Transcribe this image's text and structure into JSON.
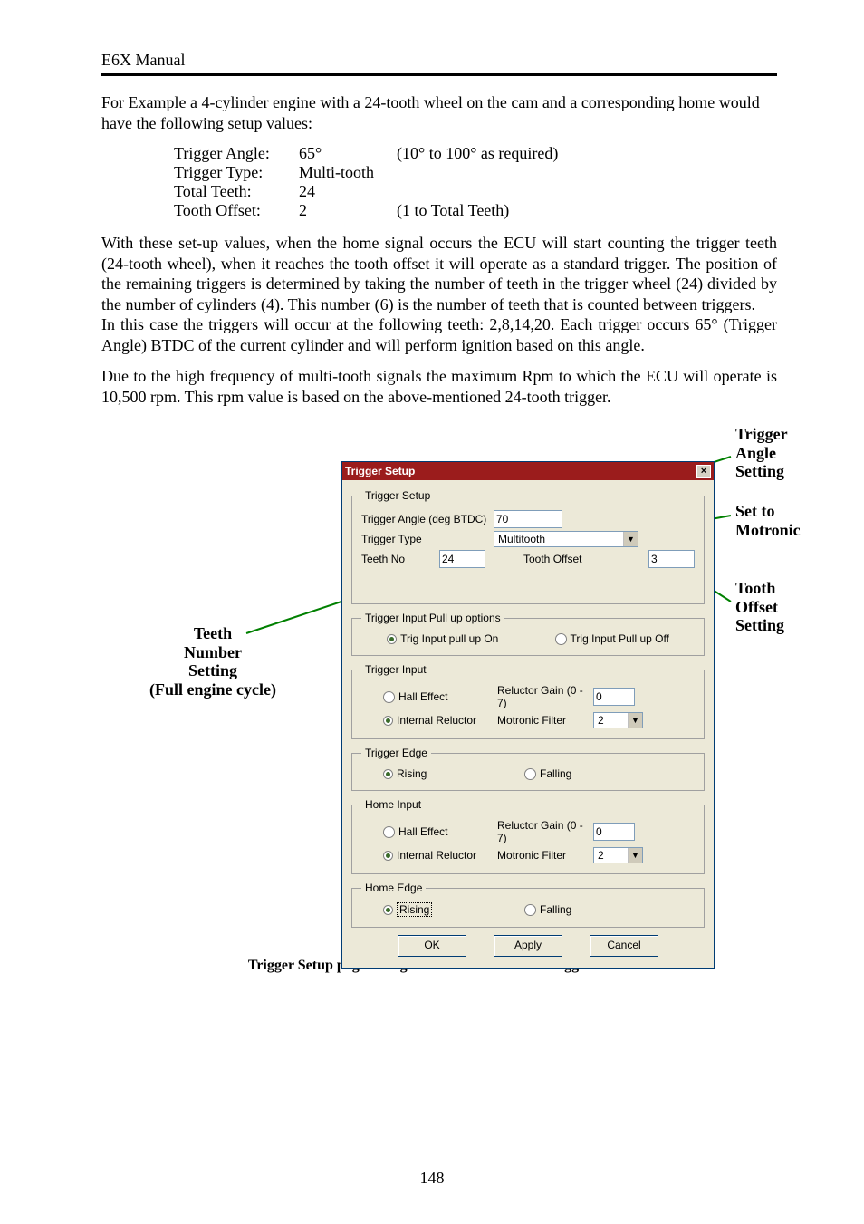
{
  "doc": {
    "header": "E6X Manual",
    "intro": "For Example a 4-cylinder engine with a 24-tooth wheel on the cam and a corresponding home would have the following setup values:",
    "setup": {
      "rows": [
        {
          "label": "Trigger Angle:",
          "value": "65°",
          "note": "(10° to 100° as required)"
        },
        {
          "label": "Trigger Type:",
          "value": "Multi-tooth",
          "note": ""
        },
        {
          "label": "Total Teeth:",
          "value": "24",
          "note": ""
        },
        {
          "label": "Tooth Offset:",
          "value": "2",
          "note": "(1 to Total Teeth)"
        }
      ]
    },
    "para2": "With these set-up values, when the home signal occurs the ECU will start counting the trigger teeth (24-tooth wheel), when it reaches the tooth offset it will operate as a standard trigger.  The position of the remaining triggers is determined by taking the number of teeth in the trigger wheel (24) divided by the number of cylinders (4).  This number (6) is the number of teeth that is counted between triggers.",
    "para3": "In this case the triggers will occur at the following teeth: 2,8,14,20.   Each trigger occurs 65° (Trigger Angle) BTDC of the current cylinder and will perform ignition based on this angle.",
    "para4": "Due to the high frequency of multi-tooth signals the maximum Rpm to which the ECU will operate is 10,500 rpm.  This rpm value is based on the above-mentioned 24-tooth trigger.",
    "caption": "Trigger Setup page configuration for Multitooth trigger wheel",
    "pagenum": "148"
  },
  "callouts": {
    "left1": "Teeth",
    "left2": "Number",
    "left3": "Setting",
    "left4": "(Full engine cycle)",
    "r1a": "Trigger",
    "r1b": "Angle",
    "r1c": "Setting",
    "r2a": "Set to",
    "r2b": "Motronic",
    "r3a": "Tooth",
    "r3b": "Offset",
    "r3c": "Setting"
  },
  "dlg": {
    "title": "Trigger Setup",
    "close": "×",
    "grp_trigger": {
      "legend": "Trigger Setup",
      "angle_label": "Trigger Angle (deg BTDC)",
      "angle_value": "70",
      "type_label": "Trigger Type",
      "type_value": "Multitooth",
      "teeth_label": "Teeth No",
      "teeth_value": "24",
      "offset_label": "Tooth Offset",
      "offset_value": "3"
    },
    "grp_pullup": {
      "legend": "Trigger Input Pull up options",
      "on": "Trig Input pull up On",
      "off": "Trig Input Pull up Off"
    },
    "grp_triginput": {
      "legend": "Trigger Input",
      "hall": "Hall Effect",
      "reluctor": "Internal Reluctor",
      "gain_label": "Reluctor Gain (0 - 7)",
      "gain_value": "0",
      "filter_label": "Motronic Filter",
      "filter_value": "2"
    },
    "grp_trigedge": {
      "legend": "Trigger Edge",
      "rising": "Rising",
      "falling": "Falling"
    },
    "grp_homeinput": {
      "legend": "Home Input",
      "hall": "Hall Effect",
      "reluctor": "Internal Reluctor",
      "gain_label": "Reluctor Gain (0 - 7)",
      "gain_value": "0",
      "filter_label": "Motronic Filter",
      "filter_value": "2"
    },
    "grp_homeedge": {
      "legend": "Home Edge",
      "rising": "Rising",
      "falling": "Falling"
    },
    "btn_ok": "OK",
    "btn_apply": "Apply",
    "btn_cancel": "Cancel"
  }
}
